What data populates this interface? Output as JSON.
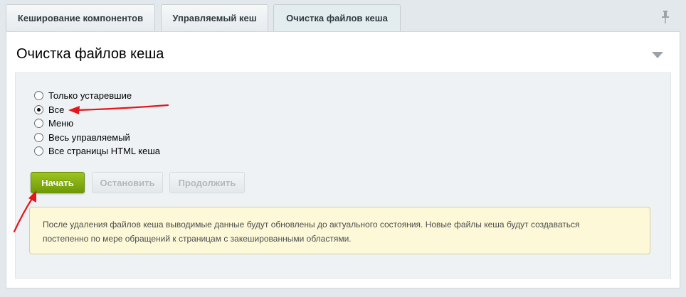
{
  "tabs": [
    {
      "label": "Кеширование компонентов",
      "active": false
    },
    {
      "label": "Управляемый кеш",
      "active": false
    },
    {
      "label": "Очистка файлов кеша",
      "active": true
    }
  ],
  "panel": {
    "title": "Очистка файлов кеша"
  },
  "options": [
    {
      "label": "Только устаревшие",
      "checked": false
    },
    {
      "label": "Все",
      "checked": true
    },
    {
      "label": "Меню",
      "checked": false
    },
    {
      "label": "Весь управляемый",
      "checked": false
    },
    {
      "label": "Все страницы HTML кеша",
      "checked": false
    }
  ],
  "buttons": {
    "start": "Начать",
    "stop": "Остановить",
    "continue": "Продолжить"
  },
  "note": {
    "line1": "После удаления файлов кеша выводимые данные будут обновлены до актуального состояния. Новые файлы кеша будут создаваться",
    "line2": "постепенно по мере обращений к страницам с закешированными областями."
  },
  "colors": {
    "accent_green": "#7ba50f",
    "annotation_red": "#e3161d",
    "note_bg": "#fdf8d7"
  },
  "icons": [
    "pin-icon",
    "collapse-arrow-icon"
  ]
}
